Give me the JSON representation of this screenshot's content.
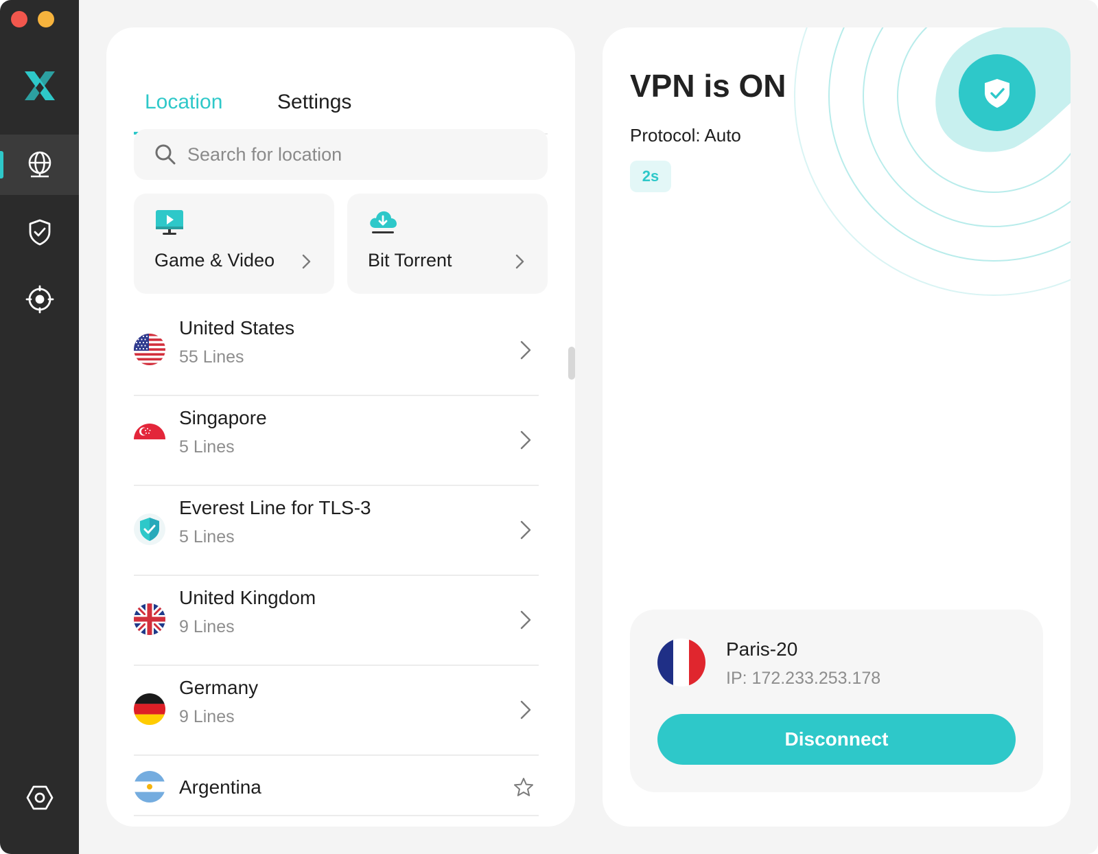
{
  "window": {
    "title": "VPN"
  },
  "sidebar": {
    "items": [
      {
        "name": "locations",
        "icon": "globe-icon",
        "active": true
      },
      {
        "name": "security",
        "icon": "shield-check-icon",
        "active": false
      },
      {
        "name": "target",
        "icon": "target-icon",
        "active": false
      },
      {
        "name": "settings",
        "icon": "hexagon-settings-icon",
        "active": false
      }
    ]
  },
  "tabs": {
    "location": "Location",
    "settings": "Settings",
    "active": "location"
  },
  "search": {
    "placeholder": "Search for location"
  },
  "quick_actions": [
    {
      "label": "Game & Video",
      "icon": "monitor-play-icon"
    },
    {
      "label": "Bit Torrent",
      "icon": "cloud-download-icon"
    }
  ],
  "locations": [
    {
      "name": "United States",
      "lines": "55 Lines",
      "flag": "us"
    },
    {
      "name": "Singapore",
      "lines": "5 Lines",
      "flag": "sg"
    },
    {
      "name": "Everest Line for TLS-3",
      "lines": "5 Lines",
      "flag": "shield"
    },
    {
      "name": "United Kingdom",
      "lines": "9 Lines",
      "flag": "uk"
    },
    {
      "name": "Germany",
      "lines": "9 Lines",
      "flag": "de"
    },
    {
      "name": "Argentina",
      "lines": "",
      "flag": "ar"
    }
  ],
  "status": {
    "title": "VPN is ON",
    "protocol": "Protocol: Auto",
    "timer": "2s"
  },
  "connection": {
    "server": "Paris-20",
    "ip": "IP: 172.233.253.178",
    "button": "Disconnect"
  },
  "colors": {
    "accent": "#2ec8c9",
    "sidebar": "#2b2b2b",
    "background": "#f4f4f4"
  }
}
